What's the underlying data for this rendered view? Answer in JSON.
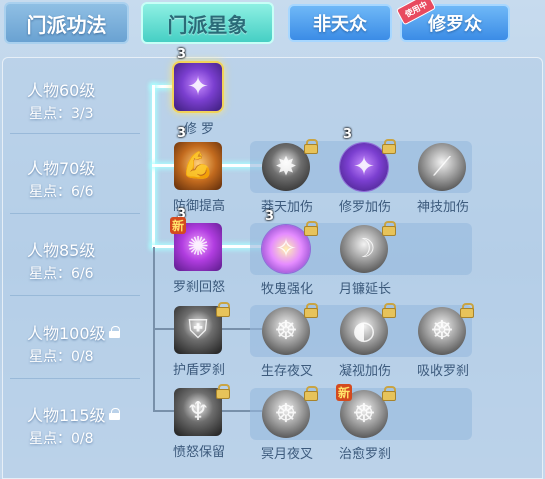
{
  "tabs": {
    "gongfa": "门派功法",
    "xingxiang": "门派星象",
    "feitian": "非天众",
    "xiuluo": "修罗众",
    "in_use_badge": "使用中"
  },
  "levels": [
    {
      "title": "人物60级",
      "stars": "星点：3/3",
      "locked": false
    },
    {
      "title": "人物70级",
      "stars": "星点：6/6",
      "locked": false
    },
    {
      "title": "人物85级",
      "stars": "星点：6/6",
      "locked": false
    },
    {
      "title": "人物100级",
      "stars": "星点：0/8",
      "locked": true
    },
    {
      "title": "人物115级",
      "stars": "星点：0/8",
      "locked": true
    }
  ],
  "skills": {
    "row1": [
      {
        "name": "修 罗",
        "level": "3",
        "icon": "asura-icon"
      }
    ],
    "row2": [
      {
        "name": "防御提高",
        "level": "3",
        "icon": "defense-up-icon"
      },
      {
        "name": "莽天加伤",
        "level": "",
        "icon": "sky-damage-icon",
        "locked": true
      },
      {
        "name": "修罗加伤",
        "level": "3",
        "icon": "asura-damage-icon",
        "locked": true
      },
      {
        "name": "神技加伤",
        "level": "",
        "icon": "divine-skill-icon"
      }
    ],
    "row3": [
      {
        "name": "罗刹回怒",
        "level": "3",
        "icon": "rakshasa-rage-icon",
        "new": true
      },
      {
        "name": "牧鬼强化",
        "level": "3",
        "icon": "ghost-herding-icon",
        "locked": true
      },
      {
        "name": "月镰延长",
        "level": "",
        "icon": "moon-scythe-icon",
        "locked": true
      }
    ],
    "row4": [
      {
        "name": "护盾罗刹",
        "level": "",
        "icon": "shield-rakshasa-icon",
        "locked": true
      },
      {
        "name": "生存夜叉",
        "level": "",
        "icon": "survival-yaksha-icon",
        "locked": true
      },
      {
        "name": "凝视加伤",
        "level": "",
        "icon": "gaze-damage-icon",
        "locked": true
      },
      {
        "name": "吸收罗刹",
        "level": "",
        "icon": "absorb-rakshasa-icon",
        "locked": true
      }
    ],
    "row5": [
      {
        "name": "愤怒保留",
        "level": "",
        "icon": "rage-retain-icon",
        "locked": true
      },
      {
        "name": "冥月夜叉",
        "level": "",
        "icon": "nether-moon-yaksha-icon",
        "locked": true
      },
      {
        "name": "治愈罗刹",
        "level": "",
        "icon": "heal-rakshasa-icon",
        "locked": true,
        "new": true
      }
    ]
  },
  "badges": {
    "new": "新"
  }
}
